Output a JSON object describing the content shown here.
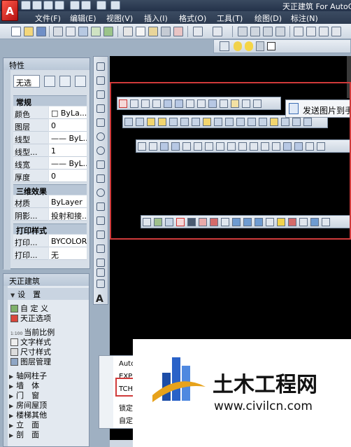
{
  "window": {
    "title": "天正建筑 For AutoCA",
    "app_logo": "A"
  },
  "menubar": {
    "items": [
      "文件(F)",
      "编辑(E)",
      "视图(V)",
      "插入(I)",
      "格式(O)",
      "工具(T)",
      "绘图(D)",
      "标注(N)"
    ]
  },
  "context_popup": {
    "label": "发送图片到手"
  },
  "properties": {
    "title": "特性",
    "selection": "无选",
    "sections": [
      {
        "name": "常规",
        "rows": [
          [
            "颜色",
            "□ ByLa..."
          ],
          [
            "图层",
            "0"
          ],
          [
            "线型",
            "—— ByL..."
          ],
          [
            "线型...",
            "1"
          ],
          [
            "线宽",
            "—— ByL..."
          ],
          [
            "厚度",
            "0"
          ]
        ]
      },
      {
        "name": "三维效果",
        "rows": [
          [
            "材质",
            "ByLayer"
          ],
          [
            "阴影...",
            "投射和接..."
          ]
        ]
      },
      {
        "name": "打印样式",
        "rows": [
          [
            "打印...",
            "BYCOLOR"
          ],
          [
            "打印...",
            "无"
          ]
        ]
      }
    ]
  },
  "tianzheng": {
    "title": "天正建筑",
    "settings": "设　置",
    "items": [
      "自 定 义",
      "天正选项",
      "当前比例",
      "文字样式",
      "尺寸样式",
      "图层管理"
    ],
    "scale_icon_label": "1:100",
    "submenus": [
      "轴网柱子",
      "墙　体",
      "门　窗",
      "房间屋顶",
      "楼梯其他",
      "立　面",
      "剖　面"
    ]
  },
  "autocomplete": {
    "items": [
      "Auto",
      "EXP",
      "TCH",
      "锁定",
      "自定"
    ]
  },
  "watermark": {
    "name": "土木工程网",
    "url": "www.civilcn.com"
  },
  "colors": {
    "accent_red": "#d03a3a",
    "title_bar": "#2c3a50",
    "drawing_bg": "#000000"
  }
}
